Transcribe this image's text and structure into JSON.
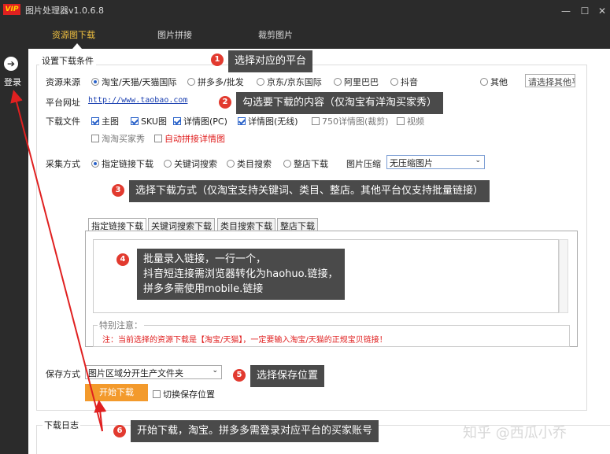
{
  "app": {
    "title": "图片处理器v1.0.6.8",
    "logo": "VIP"
  },
  "window": {
    "minimize": "—",
    "maximize": "☐",
    "close": "✕"
  },
  "tabs": [
    "资源图下载",
    "图片拼接",
    "裁剪图片"
  ],
  "sidebar": {
    "login_icon": "➔",
    "login_label": "登录"
  },
  "section": {
    "legend": "设置下载条件"
  },
  "source": {
    "label": "资源来源",
    "options": [
      "淘宝/天猫/天猫国际",
      "拼多多/批发",
      "京东/京东国际",
      "阿里巴巴",
      "抖音",
      "其他"
    ],
    "selected": "淘宝/天猫/天猫国际",
    "other_placeholder": "请选择其他平"
  },
  "platform_url": {
    "label": "平台网址",
    "value": "http://www.taobao.com"
  },
  "download_files": {
    "label": "下载文件",
    "options": [
      {
        "label": "主图",
        "checked": true
      },
      {
        "label": "SKU图",
        "checked": true
      },
      {
        "label": "详情图(PC)",
        "checked": true
      },
      {
        "label": "详情图(无线)",
        "checked": true
      },
      {
        "label": "750详情图(裁剪)",
        "checked": false
      },
      {
        "label": "视频",
        "checked": false
      },
      {
        "label": "淘淘买家秀",
        "checked": false
      },
      {
        "label": "自动拼接详情图",
        "checked": false
      }
    ]
  },
  "collect": {
    "label": "采集方式",
    "options": [
      "指定链接下载",
      "关键词搜索",
      "类目搜索",
      "整店下载"
    ],
    "selected": "指定链接下载",
    "compress_label": "图片压缩",
    "compress_value": "无压缩图片"
  },
  "inner_tabs": [
    "指定链接下载",
    "关键词搜索下载",
    "类目搜索下载",
    "整店下载"
  ],
  "note": {
    "title": "特别注意：",
    "text": "注：当前选择的资源下载是【淘宝/天猫】，一定要输入淘宝/天猫的正规宝贝链接！"
  },
  "save": {
    "label": "保存方式",
    "value": "图片区域分开生产文件夹",
    "start_button": "开始下载",
    "switch_label": "切换保存位置"
  },
  "log": {
    "label": "下载日志"
  },
  "callouts": [
    {
      "num": "1",
      "text": "选择对应的平台"
    },
    {
      "num": "2",
      "text": "勾选要下载的内容（仅淘宝有洋淘买家秀）"
    },
    {
      "num": "3",
      "text": "选择下载方式（仅淘宝支持关键词、类目、整店。其他平台仅支持批量链接）"
    },
    {
      "num": "4",
      "lines": [
        "批量录入链接，一行一个，",
        "抖音短连接需浏览器转化为haohuo.链接，",
        "拼多多需使用mobile.链接"
      ]
    },
    {
      "num": "5",
      "text": "选择保存位置"
    },
    {
      "num": "6",
      "text": "开始下载，淘宝。拼多多需登录对应平台的买家账号"
    }
  ],
  "watermark": "知乎 @西瓜小乔",
  "colors": {
    "accent": "#f0c040",
    "badge": "#e23a2f",
    "callout_bg": "#4a4a4a",
    "start_button": "#f39a2c",
    "arrow": "#e02020"
  }
}
